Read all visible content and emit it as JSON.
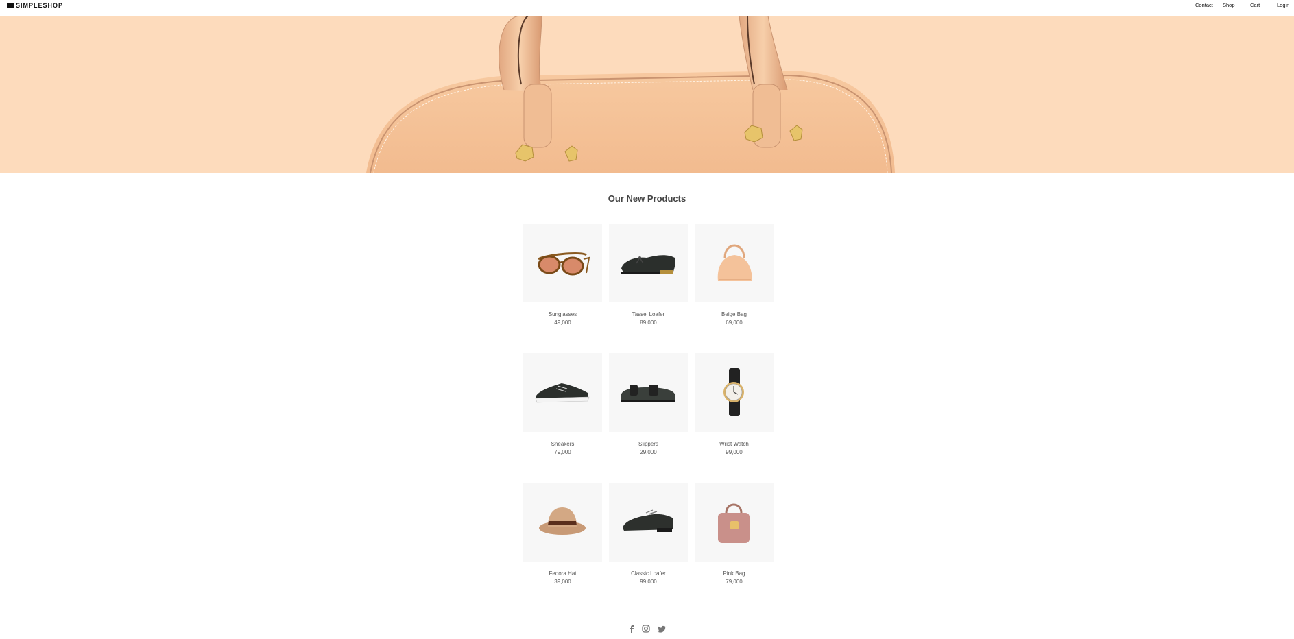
{
  "header": {
    "logo_text": "SIMPLESHOP",
    "nav": [
      "Contact",
      "Shop",
      "Cart",
      "Login"
    ]
  },
  "hero": {
    "background_color": "#fddbbc",
    "image": "beige-handbag-banner"
  },
  "section": {
    "title": "Our New Products"
  },
  "products": [
    {
      "name": "Sunglasses",
      "price": "49,000",
      "image": "sunglasses"
    },
    {
      "name": "Tassel Loafer",
      "price": "89,000",
      "image": "tassel-loafer"
    },
    {
      "name": "Beige Bag",
      "price": "69,000",
      "image": "beige-bag"
    },
    {
      "name": "Sneakers",
      "price": "79,000",
      "image": "sneakers"
    },
    {
      "name": "Slippers",
      "price": "29,000",
      "image": "slippers"
    },
    {
      "name": "Wrist Watch",
      "price": "99,000",
      "image": "wrist-watch"
    },
    {
      "name": "Fedora Hat",
      "price": "39,000",
      "image": "fedora-hat"
    },
    {
      "name": "Classic Loafer",
      "price": "99,000",
      "image": "classic-loafer"
    },
    {
      "name": "Pink Bag",
      "price": "79,000",
      "image": "pink-bag"
    }
  ],
  "footer": {
    "social": [
      "facebook-icon",
      "instagram-icon",
      "twitter-icon"
    ]
  }
}
